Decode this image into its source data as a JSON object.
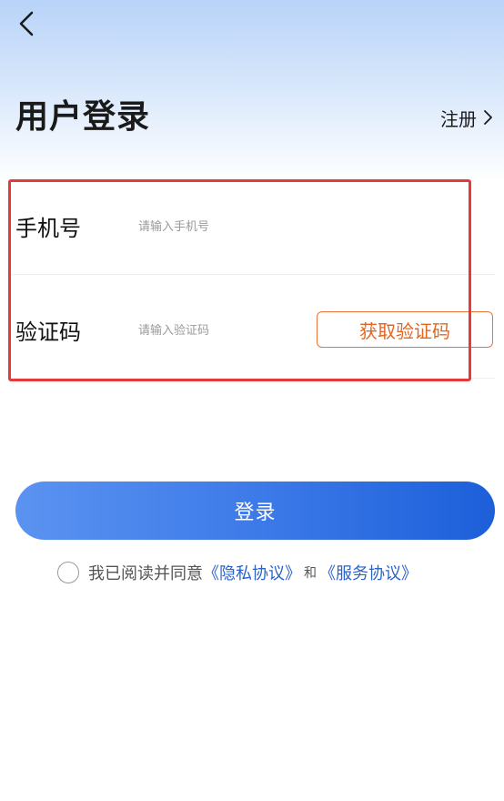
{
  "header": {
    "back_icon": "chevron-left-icon",
    "title": "用户登录",
    "register_label": "注册",
    "register_icon": "chevron-right-icon"
  },
  "form": {
    "phone": {
      "label": "手机号",
      "value": "",
      "placeholder": "请输入手机号"
    },
    "code": {
      "label": "验证码",
      "value": "",
      "placeholder": "请输入验证码",
      "button_label": "获取验证码"
    }
  },
  "login_button_label": "登录",
  "agreement": {
    "checked": false,
    "prefix": "我已阅读并同意",
    "privacy_link": "《隐私协议》",
    "and": "和",
    "service_link": "《服务协议》"
  },
  "colors": {
    "primary": "#3a78e8",
    "accent_orange": "#e2661f",
    "highlight_red": "#e33b3b",
    "link_blue": "#2b63c8"
  }
}
